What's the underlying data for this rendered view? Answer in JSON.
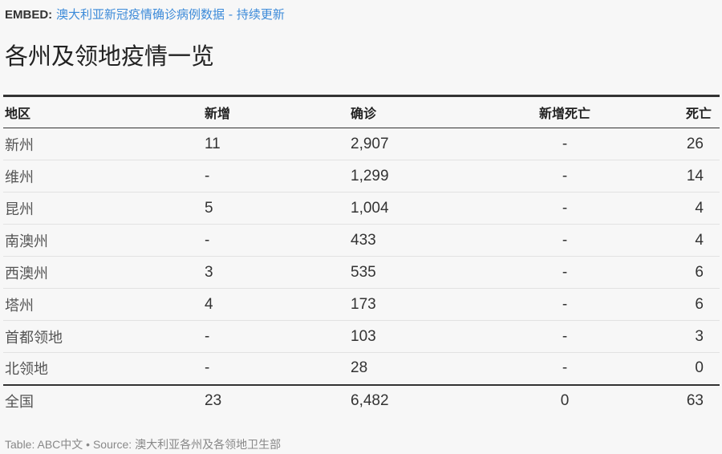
{
  "embed": {
    "tag": "EMBED:",
    "link": "澳大利亚新冠疫情确诊病例数据 - 持续更新"
  },
  "title": "各州及领地疫情一览",
  "table": {
    "headers": [
      "地区",
      "新增",
      "确诊",
      "新增死亡",
      "死亡"
    ],
    "rows": [
      [
        "新州",
        "11",
        "2,907",
        "-",
        "26"
      ],
      [
        "维州",
        "-",
        "1,299",
        "-",
        "14"
      ],
      [
        "昆州",
        "5",
        "1,004",
        "-",
        "4"
      ],
      [
        "南澳州",
        "-",
        "433",
        "-",
        "4"
      ],
      [
        "西澳州",
        "3",
        "535",
        "-",
        "6"
      ],
      [
        "塔州",
        "4",
        "173",
        "-",
        "6"
      ],
      [
        "首都领地",
        "-",
        "103",
        "-",
        "3"
      ],
      [
        "北领地",
        "-",
        "28",
        "-",
        "0"
      ]
    ],
    "total": [
      "全国",
      "23",
      "6,482",
      "0",
      "63"
    ]
  },
  "footer": "Table: ABC中文 • Source: 澳大利亚各州及各领地卫生部"
}
